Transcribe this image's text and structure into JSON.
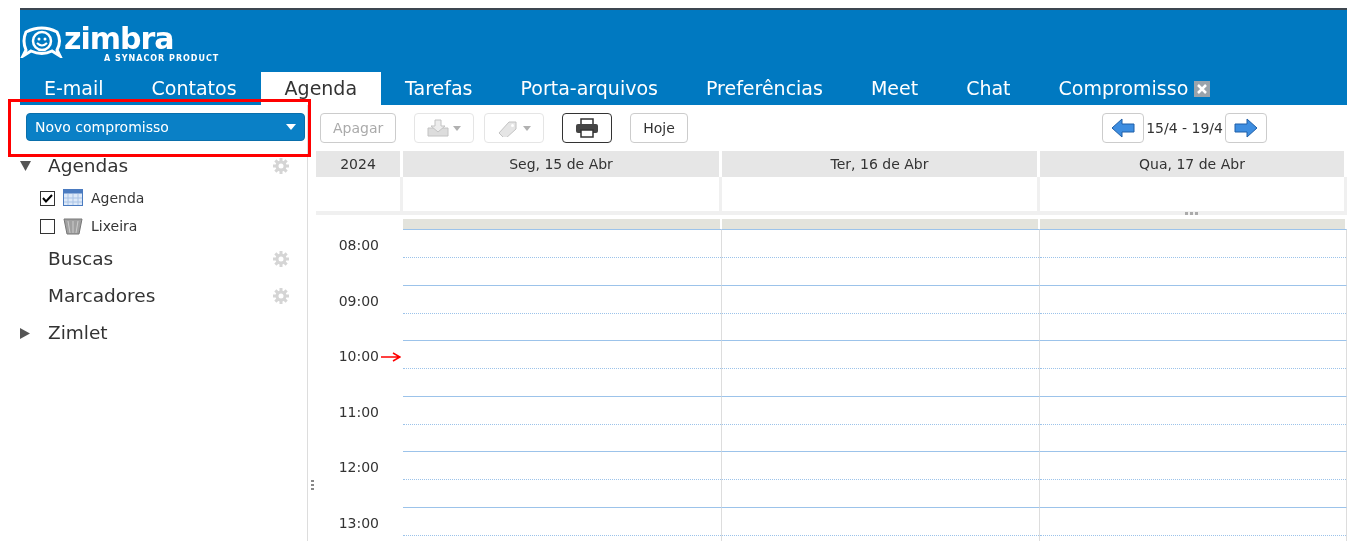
{
  "logo": {
    "name": "zimbra",
    "tagline": "A SYNACOR PRODUCT"
  },
  "tabs": [
    {
      "label": "E-mail",
      "selected": false,
      "closable": false
    },
    {
      "label": "Contatos",
      "selected": false,
      "closable": false
    },
    {
      "label": "Agenda",
      "selected": true,
      "closable": false
    },
    {
      "label": "Tarefas",
      "selected": false,
      "closable": false
    },
    {
      "label": "Porta-arquivos",
      "selected": false,
      "closable": false
    },
    {
      "label": "Preferências",
      "selected": false,
      "closable": false
    },
    {
      "label": "Meet",
      "selected": false,
      "closable": false
    },
    {
      "label": "Chat",
      "selected": false,
      "closable": false
    },
    {
      "label": "Compromisso",
      "selected": false,
      "closable": true
    }
  ],
  "new_button": {
    "label": "Novo compromisso",
    "highlighted": true
  },
  "toolbar": {
    "delete": {
      "label": "Apagar",
      "disabled": true
    },
    "move_disabled": true,
    "tag_disabled": true,
    "today": "Hoje",
    "range": "15/4 - 19/4"
  },
  "sidebar": {
    "sections": [
      {
        "label": "Agendas",
        "expanded": true,
        "settings": true,
        "children": [
          {
            "label": "Agenda",
            "checked": true,
            "kind": "calendar"
          },
          {
            "label": "Lixeira",
            "checked": false,
            "kind": "trash"
          }
        ]
      },
      {
        "label": "Buscas",
        "settings": true
      },
      {
        "label": "Marcadores",
        "settings": true
      },
      {
        "label": "Zimlet",
        "expanded": false,
        "settings": false
      }
    ]
  },
  "calendar": {
    "year": "2024",
    "days": [
      "Seg, 15 de Abr",
      "Ter, 16 de Abr",
      "Qua, 17 de Abr"
    ],
    "hours": [
      {
        "label": "08:00",
        "current": false
      },
      {
        "label": "09:00",
        "current": false
      },
      {
        "label": "10:00",
        "current": true
      },
      {
        "label": "11:00",
        "current": false
      },
      {
        "label": "12:00",
        "current": false
      },
      {
        "label": "13:00",
        "current": false
      }
    ]
  }
}
